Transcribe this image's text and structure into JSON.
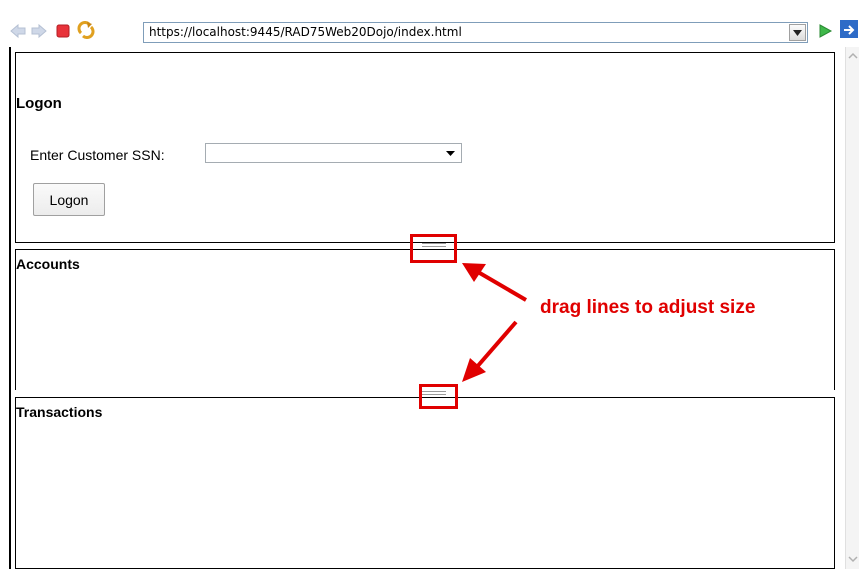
{
  "browser": {
    "url": "https://localhost:9445/RAD75Web20Dojo/index.html",
    "icons": [
      "back-arrow-icon",
      "forward-arrow-icon",
      "stop-icon",
      "refresh-icon",
      "url-dropdown-icon",
      "go-icon",
      "browser-logo-icon"
    ]
  },
  "logon": {
    "title": "Logon",
    "ssn_label": "Enter Customer SSN:",
    "ssn_value": "",
    "button_label": "Logon"
  },
  "accounts": {
    "title": "Accounts"
  },
  "transactions": {
    "title": "Transactions"
  },
  "annotation": {
    "text": "drag lines to adjust size",
    "color": "#e00000"
  }
}
